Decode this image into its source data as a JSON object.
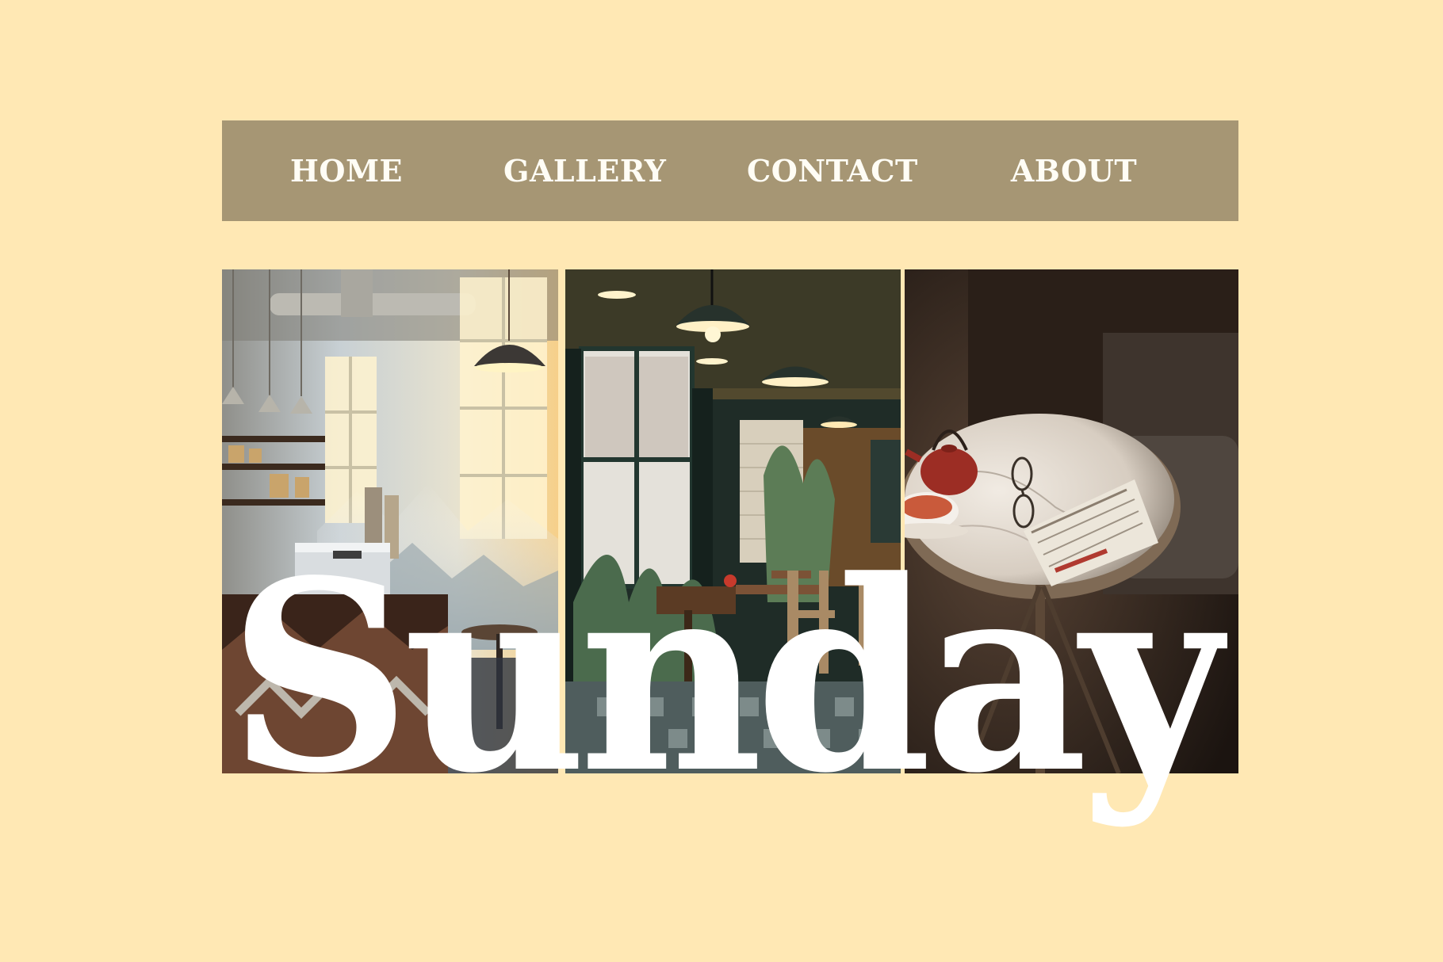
{
  "nav": {
    "items": [
      {
        "label": "HOME"
      },
      {
        "label": "GALLERY"
      },
      {
        "label": "CONTACT"
      },
      {
        "label": "ABOUT"
      }
    ]
  },
  "hero": {
    "word": "Sunday"
  },
  "colors": {
    "background": "#ffe8b4",
    "nav_bar": "#a69674",
    "nav_text": "#fffdf5",
    "hero_text": "#ffffff"
  },
  "icons": {
    "lamp": "pendant-lamp-icon",
    "plant": "potted-plant-icon",
    "teapot": "teapot-icon",
    "teacup": "teacup-icon",
    "newspaper": "newspaper-icon",
    "glasses": "glasses-icon"
  }
}
